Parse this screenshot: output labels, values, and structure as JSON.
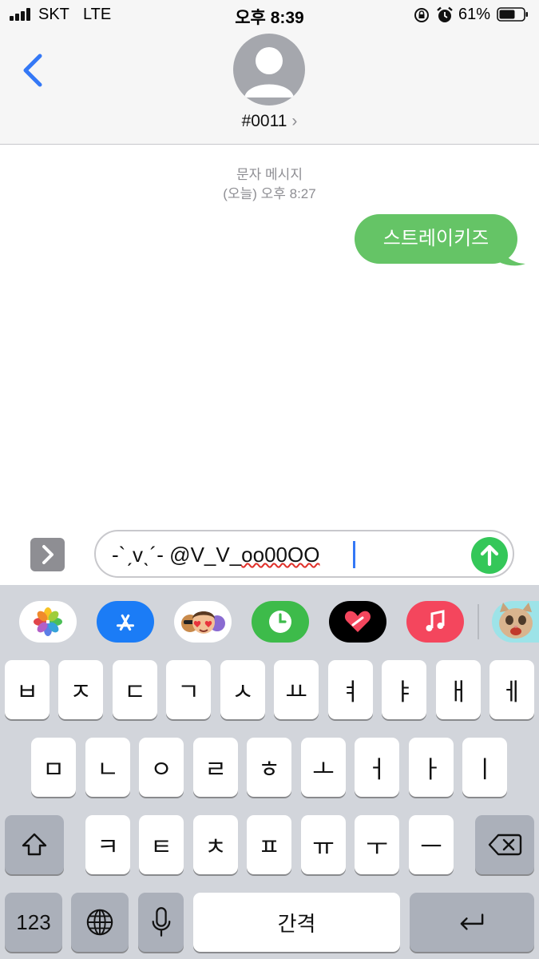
{
  "status": {
    "carrier": "SKT",
    "network": "LTE",
    "time": "오후 8:39",
    "battery": "61%"
  },
  "header": {
    "contact_name": "#0011",
    "contact_chevron": "›"
  },
  "conversation": {
    "type_label": "문자 메시지",
    "timestamp": "(오늘) 오후 8:27",
    "messages": [
      {
        "direction": "sent",
        "text": "스트레이키즈"
      }
    ]
  },
  "composer": {
    "text_before": "-`ˏvˎ´- @V_V_",
    "text_misspelled": "oo00OO"
  },
  "app_strip": {
    "icons": [
      "photos-icon",
      "app-store-icon",
      "memoji-icon",
      "activity-icon",
      "digital-touch-icon",
      "music-icon",
      "animoji-cat-icon"
    ],
    "colors": {
      "app_store": "#1b7cf6",
      "activity": "#3dbb4a",
      "music": "#f4465d",
      "digital_touch": "#000000"
    }
  },
  "keyboard": {
    "row1": [
      "ㅂ",
      "ㅈ",
      "ㄷ",
      "ㄱ",
      "ㅅ",
      "ㅛ",
      "ㅕ",
      "ㅑ",
      "ㅐ",
      "ㅔ"
    ],
    "row2": [
      "ㅁ",
      "ㄴ",
      "ㅇ",
      "ㄹ",
      "ㅎ",
      "ㅗ",
      "ㅓ",
      "ㅏ",
      "ㅣ"
    ],
    "row3": [
      "ㅋ",
      "ㅌ",
      "ㅊ",
      "ㅍ",
      "ㅠ",
      "ㅜ",
      "ㅡ"
    ],
    "numbers_label": "123",
    "space_label": "간격"
  },
  "colors": {
    "bubble_sent": "#65c466",
    "send_button": "#34c759",
    "accent": "#3478f6"
  }
}
